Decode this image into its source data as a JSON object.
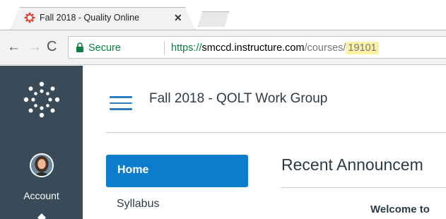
{
  "browser": {
    "tab": {
      "title": "Fall 2018 - Quality Online",
      "close_glyph": "✕",
      "favicon": "canvas-favicon-icon"
    },
    "new_tab": "new-tab-icon",
    "toolbar": {
      "back_glyph": "←",
      "forward_glyph": "→",
      "reload_glyph": "C",
      "secure_label": "Secure",
      "url": {
        "scheme": "https://",
        "host": "smccd.instructure.com",
        "path": "/courses/",
        "course_id": "19101"
      },
      "colors": {
        "secure": "#0b8043",
        "highlight": "#fbf3a3"
      }
    }
  },
  "global_nav": {
    "logo": "canvas-logo-icon",
    "account_label": "Account",
    "colors": {
      "background": "#394b58"
    }
  },
  "course": {
    "title": "Fall 2018 - QOLT Work Group",
    "menu_icon": "hamburger-icon",
    "nav": {
      "items": [
        {
          "label": "Home",
          "active": true
        },
        {
          "label": "Syllabus",
          "active": false
        }
      ]
    },
    "main": {
      "heading": "Recent Announcem",
      "announcement_title": "Welcome to"
    },
    "colors": {
      "accent": "#0c7ccd",
      "menu": "#2d7fc1"
    }
  }
}
